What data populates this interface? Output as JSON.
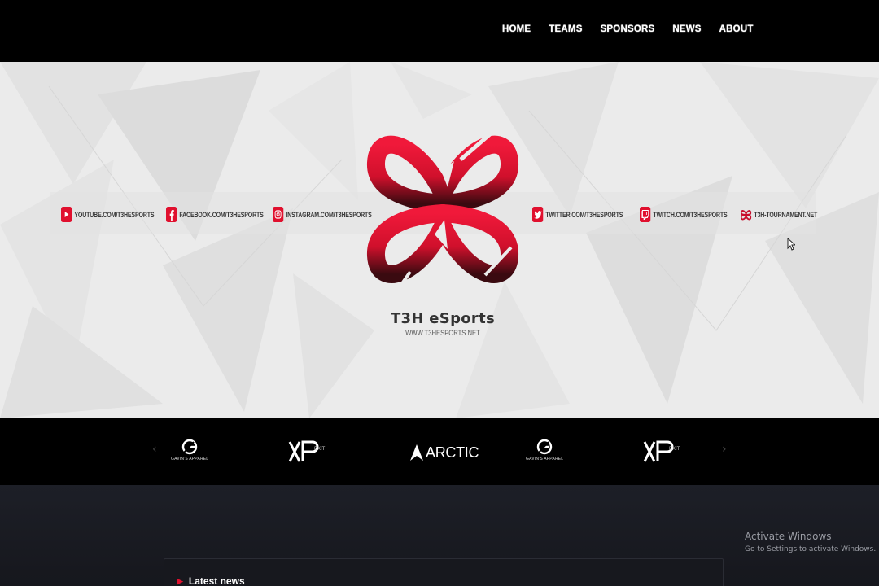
{
  "nav": {
    "items": [
      "HOME",
      "TEAMS",
      "SPONSORS",
      "NEWS",
      "ABOUT"
    ]
  },
  "hero": {
    "brand_name": "T3H eSports",
    "brand_url": "WWW.T3HESPORTS.NET",
    "social": [
      {
        "icon": "youtube-icon",
        "label": "YOUTUBE.COM/T3HESPORTS"
      },
      {
        "icon": "facebook-icon",
        "label": "FACEBOOK.COM/T3HESPORTS"
      },
      {
        "icon": "instagram-icon",
        "label": "INSTAGRAM.COM/T3HESPORTS"
      },
      {
        "icon": "twitter-icon",
        "label": "TWITTER.COM/T3HESPORTS"
      },
      {
        "icon": "twitch-icon",
        "label": "TWITCH.COM/T3HESPORTS"
      },
      {
        "icon": "t3h-logo-icon",
        "label": "T3H-TOURNAMENT.NET"
      }
    ]
  },
  "sponsors": {
    "gavin_label": "GAVIN'S APPAREL",
    "arctic_label": "ARCTIC",
    "xp_label": "XP",
    "xp_tag": "EXIT"
  },
  "content": {
    "latest_news": "Latest news"
  },
  "windows": {
    "activate_title": "Activate Windows",
    "activate_sub": "Go to Settings to activate Windows."
  },
  "colors": {
    "accent": "#e0102e",
    "topbar": "#000000",
    "page_bg": "#1a1c22"
  }
}
